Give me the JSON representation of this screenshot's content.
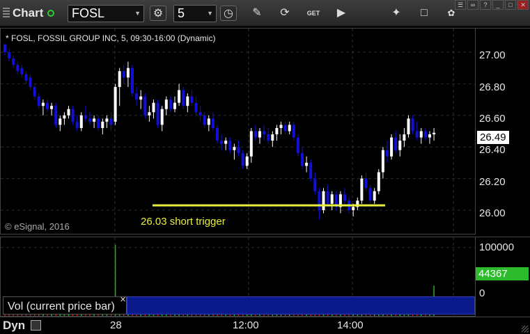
{
  "toolbar": {
    "title": "Chart",
    "symbol": "FOSL",
    "interval": "5",
    "icons": [
      "gear-icon",
      "clock-icon",
      "pencil-icon",
      "refresh-icon",
      "get-icon",
      "play-icon",
      "tools-icon",
      "comment-icon",
      "twitter-icon"
    ],
    "get_label": "GET"
  },
  "chart": {
    "header": "* FOSL, FOSSIL GROUP INC, 5, 09:30-16:00 (Dynamic)",
    "copyright": "© eSignal, 2016",
    "annotation": "26.03 short trigger",
    "annotation_price": 26.03,
    "last_price": "26.49",
    "price_ticks": [
      "27.00",
      "26.80",
      "26.60",
      "26.40",
      "26.20",
      "26.00"
    ],
    "volume_ticks": [
      "100000",
      "0"
    ],
    "last_volume": "44367",
    "vol_label": "Vol (current price bar)",
    "time_labels": [
      "28",
      "12:00",
      "14:00"
    ],
    "dyn_label": "Dyn",
    "colors": {
      "up": "#ffffff",
      "down": "#1010d8",
      "vol_up": "#22b022",
      "vol_down": "#c02020",
      "trigger": "#e8ee3c",
      "last_price_bg": "#ffffff",
      "last_vol_bg": "#2dbb2d"
    }
  },
  "chart_data": {
    "type": "candlestick",
    "y_range": [
      25.85,
      27.15
    ],
    "volume_range": [
      0,
      115000
    ],
    "session_breaks": [
      "28"
    ],
    "trigger_line": 26.03,
    "bars": [
      [
        27.05,
        27.05,
        26.98,
        27.0,
        6000
      ],
      [
        27.0,
        27.02,
        26.94,
        26.96,
        4000
      ],
      [
        26.96,
        26.98,
        26.9,
        26.92,
        8000
      ],
      [
        26.92,
        26.94,
        26.86,
        26.88,
        3000
      ],
      [
        26.9,
        26.92,
        26.84,
        26.86,
        5000
      ],
      [
        26.86,
        26.88,
        26.8,
        26.82,
        22000
      ],
      [
        26.84,
        26.86,
        26.76,
        26.78,
        9000
      ],
      [
        26.78,
        26.8,
        26.7,
        26.72,
        6000
      ],
      [
        26.72,
        26.74,
        26.64,
        26.66,
        5000
      ],
      [
        26.66,
        26.7,
        26.6,
        26.68,
        7000
      ],
      [
        26.68,
        26.7,
        26.62,
        26.64,
        4000
      ],
      [
        26.64,
        26.68,
        26.6,
        26.66,
        5000
      ],
      [
        26.66,
        26.68,
        26.52,
        26.54,
        10000
      ],
      [
        26.54,
        26.6,
        26.5,
        26.58,
        6000
      ],
      [
        26.58,
        26.62,
        26.54,
        26.6,
        4000
      ],
      [
        26.6,
        26.66,
        26.58,
        26.64,
        5000
      ],
      [
        26.64,
        26.66,
        26.54,
        26.56,
        6000
      ],
      [
        26.56,
        26.6,
        26.5,
        26.52,
        4000
      ],
      [
        26.52,
        26.62,
        26.5,
        26.6,
        5000
      ],
      [
        26.6,
        26.66,
        26.56,
        26.58,
        4000
      ],
      [
        26.58,
        26.62,
        26.54,
        26.56,
        6000
      ],
      [
        26.56,
        26.6,
        26.52,
        26.58,
        3000
      ],
      [
        26.58,
        26.6,
        26.5,
        26.52,
        5000
      ],
      [
        26.52,
        26.58,
        26.48,
        26.56,
        4000
      ],
      [
        26.56,
        26.6,
        26.52,
        26.58,
        3000
      ],
      [
        26.58,
        26.62,
        26.5,
        26.54,
        4000
      ],
      [
        26.56,
        26.8,
        26.54,
        26.78,
        104000
      ],
      [
        26.78,
        26.9,
        26.66,
        26.88,
        12000
      ],
      [
        26.88,
        26.92,
        26.8,
        26.84,
        8000
      ],
      [
        26.84,
        26.94,
        26.78,
        26.9,
        5000
      ],
      [
        26.9,
        26.92,
        26.72,
        26.74,
        9000
      ],
      [
        26.74,
        26.78,
        26.66,
        26.7,
        7000
      ],
      [
        26.7,
        26.76,
        26.64,
        26.72,
        5000
      ],
      [
        26.72,
        26.74,
        26.58,
        26.6,
        8000
      ],
      [
        26.6,
        26.66,
        26.56,
        26.62,
        4000
      ],
      [
        26.62,
        26.7,
        26.58,
        26.68,
        6000
      ],
      [
        26.68,
        26.7,
        26.52,
        26.54,
        9000
      ],
      [
        26.54,
        26.66,
        26.5,
        26.64,
        7000
      ],
      [
        26.64,
        26.72,
        26.6,
        26.7,
        6000
      ],
      [
        26.7,
        26.72,
        26.62,
        26.64,
        4000
      ],
      [
        26.64,
        26.72,
        26.62,
        26.68,
        5000
      ],
      [
        26.68,
        26.8,
        26.66,
        26.76,
        8000
      ],
      [
        26.76,
        26.78,
        26.64,
        26.66,
        9000
      ],
      [
        26.66,
        26.74,
        26.62,
        26.72,
        4000
      ],
      [
        26.72,
        26.76,
        26.66,
        26.68,
        3000
      ],
      [
        26.68,
        26.72,
        26.6,
        26.62,
        5000
      ],
      [
        26.62,
        26.66,
        26.56,
        26.6,
        4000
      ],
      [
        26.6,
        26.62,
        26.52,
        26.54,
        10000
      ],
      [
        26.54,
        26.6,
        26.5,
        26.58,
        5000
      ],
      [
        26.58,
        26.62,
        26.5,
        26.52,
        6000
      ],
      [
        26.52,
        26.54,
        26.42,
        26.44,
        14000
      ],
      [
        26.44,
        26.48,
        26.38,
        26.42,
        7000
      ],
      [
        26.42,
        26.46,
        26.38,
        26.44,
        4000
      ],
      [
        26.44,
        26.46,
        26.36,
        26.38,
        6000
      ],
      [
        26.38,
        26.42,
        26.32,
        26.4,
        8000
      ],
      [
        26.4,
        26.44,
        26.34,
        26.36,
        5000
      ],
      [
        26.36,
        26.38,
        26.26,
        26.28,
        9000
      ],
      [
        26.28,
        26.36,
        26.26,
        26.34,
        6000
      ],
      [
        26.34,
        26.52,
        26.3,
        26.5,
        7000
      ],
      [
        26.5,
        26.54,
        26.44,
        26.46,
        4000
      ],
      [
        26.46,
        26.52,
        26.42,
        26.5,
        5000
      ],
      [
        26.5,
        26.54,
        26.44,
        26.48,
        3000
      ],
      [
        26.48,
        26.52,
        26.42,
        26.44,
        4000
      ],
      [
        26.44,
        26.5,
        26.4,
        26.48,
        3000
      ],
      [
        26.48,
        26.54,
        26.44,
        26.52,
        5000
      ],
      [
        26.52,
        26.56,
        26.48,
        26.54,
        3000
      ],
      [
        26.54,
        26.56,
        26.48,
        26.5,
        4000
      ],
      [
        26.5,
        26.56,
        26.48,
        26.54,
        3000
      ],
      [
        26.54,
        26.56,
        26.44,
        26.46,
        6000
      ],
      [
        26.46,
        26.48,
        26.34,
        26.36,
        10000
      ],
      [
        26.36,
        26.4,
        26.26,
        26.28,
        9000
      ],
      [
        26.28,
        26.34,
        26.24,
        26.3,
        5000
      ],
      [
        26.3,
        26.32,
        26.18,
        26.2,
        8000
      ],
      [
        26.2,
        26.24,
        26.1,
        26.12,
        11000
      ],
      [
        26.12,
        26.14,
        25.94,
        26.0,
        13000
      ],
      [
        26.0,
        26.14,
        25.98,
        26.12,
        7000
      ],
      [
        26.12,
        26.16,
        26.02,
        26.04,
        6000
      ],
      [
        26.04,
        26.12,
        26.0,
        26.1,
        5000
      ],
      [
        26.1,
        26.12,
        26.0,
        26.02,
        6000
      ],
      [
        26.02,
        26.12,
        25.98,
        26.1,
        4000
      ],
      [
        26.1,
        26.14,
        26.04,
        26.06,
        3000
      ],
      [
        26.06,
        26.08,
        25.98,
        26.0,
        5000
      ],
      [
        26.0,
        26.04,
        25.96,
        26.02,
        4000
      ],
      [
        26.02,
        26.08,
        26.0,
        26.06,
        6000
      ],
      [
        26.06,
        26.22,
        26.04,
        26.2,
        9000
      ],
      [
        26.2,
        26.24,
        26.12,
        26.14,
        5000
      ],
      [
        26.14,
        26.16,
        26.04,
        26.06,
        6000
      ],
      [
        26.06,
        26.14,
        26.04,
        26.12,
        4000
      ],
      [
        26.12,
        26.26,
        26.1,
        26.24,
        8000
      ],
      [
        26.24,
        26.4,
        26.2,
        26.38,
        10000
      ],
      [
        26.38,
        26.44,
        26.3,
        26.34,
        5000
      ],
      [
        26.34,
        26.48,
        26.32,
        26.46,
        7000
      ],
      [
        26.46,
        26.5,
        26.36,
        26.38,
        5000
      ],
      [
        26.38,
        26.48,
        26.34,
        26.44,
        4000
      ],
      [
        26.44,
        26.52,
        26.4,
        26.48,
        5000
      ],
      [
        26.48,
        26.6,
        26.46,
        26.58,
        7000
      ],
      [
        26.58,
        26.6,
        26.48,
        26.5,
        6000
      ],
      [
        26.5,
        26.56,
        26.44,
        26.46,
        5000
      ],
      [
        26.46,
        26.52,
        26.42,
        26.5,
        4000
      ],
      [
        26.5,
        26.52,
        26.44,
        26.46,
        6000
      ],
      [
        26.46,
        26.5,
        26.42,
        26.48,
        12000
      ],
      [
        26.48,
        26.52,
        26.44,
        26.49,
        44367
      ]
    ]
  }
}
